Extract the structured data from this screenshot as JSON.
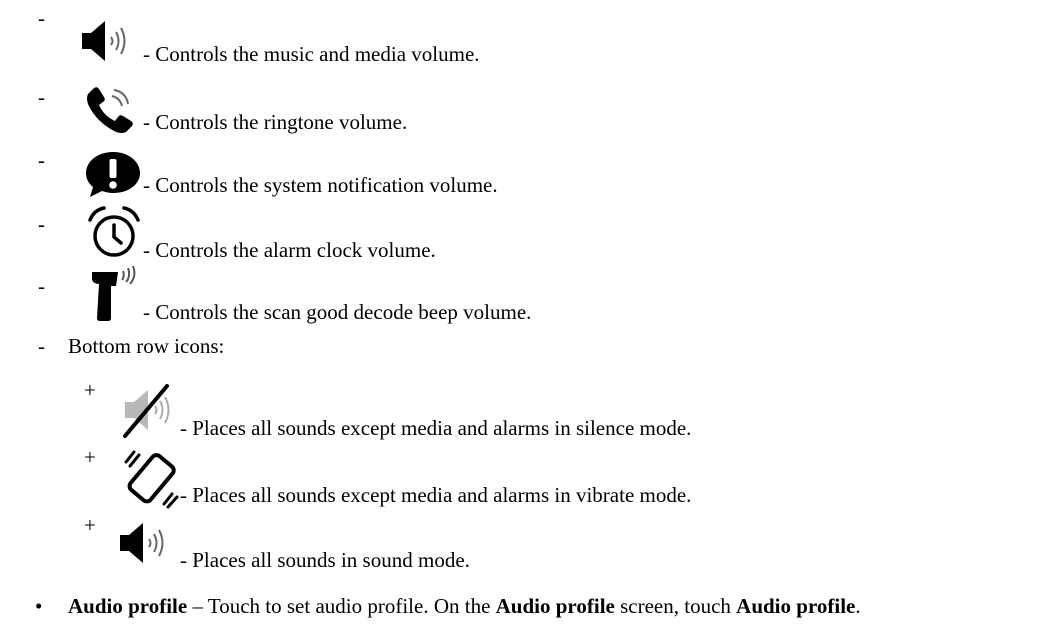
{
  "items": [
    {
      "marker": "-",
      "icon": "speaker-icon",
      "text": "- Controls the music and media volume."
    },
    {
      "marker": "-",
      "icon": "phone-ringing-icon",
      "text": "- Controls the ringtone volume."
    },
    {
      "marker": "-",
      "icon": "notification-alert-icon",
      "text": "- Controls the system notification volume."
    },
    {
      "marker": "-",
      "icon": "alarm-clock-icon",
      "text": "- Controls the alarm clock volume."
    },
    {
      "marker": "-",
      "icon": "scanner-beep-icon",
      "text": "- Controls the scan good decode beep volume."
    }
  ],
  "bottom_row": {
    "marker": "-",
    "label": "Bottom row icons:"
  },
  "sub_items": [
    {
      "marker": "+",
      "icon": "mute-icon",
      "text": "- Places all sounds except media and alarms in silence mode."
    },
    {
      "marker": "+",
      "icon": "vibrate-icon",
      "text": "- Places all sounds except media and alarms in vibrate mode."
    },
    {
      "marker": "+",
      "icon": "speaker-icon",
      "text": "- Places all sounds in sound mode."
    }
  ],
  "audio_profile": {
    "bullet": "•",
    "term": "Audio profile",
    "dash": " – ",
    "text1": "Touch to set audio profile. On the ",
    "term2": "Audio profile",
    "text2": " screen, touch ",
    "term3": "Audio profile",
    "text3": "."
  }
}
